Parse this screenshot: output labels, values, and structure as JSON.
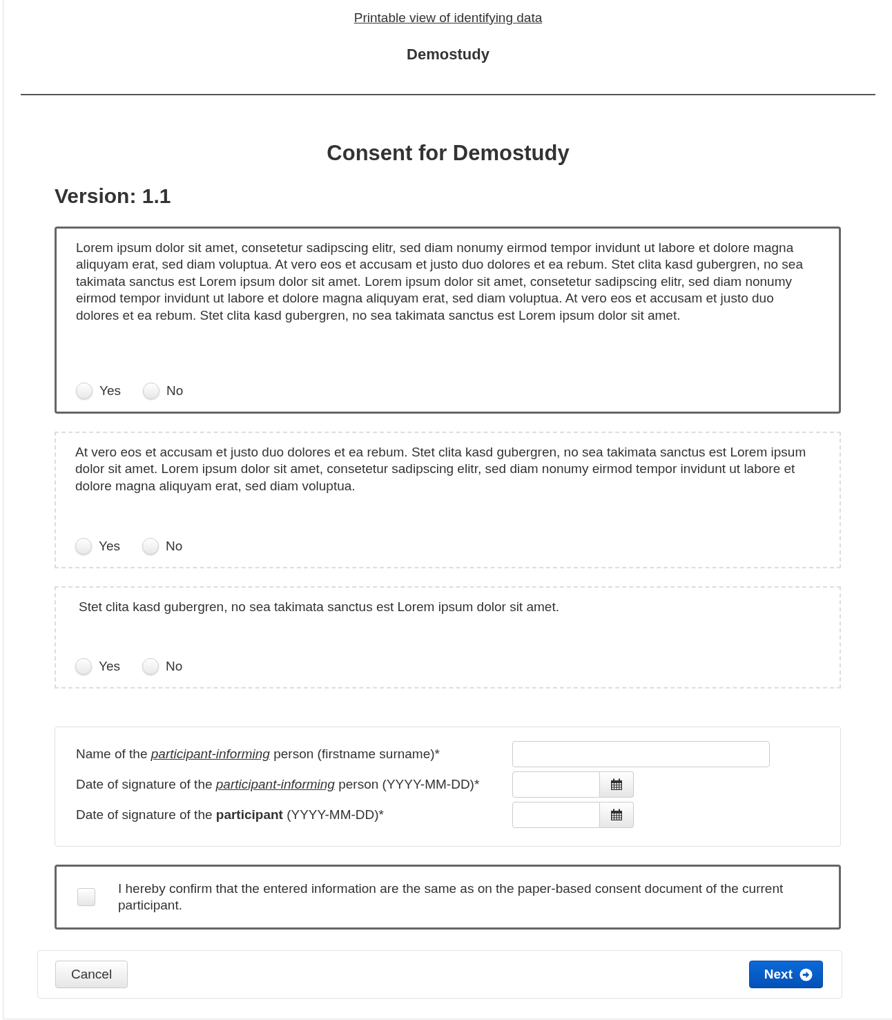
{
  "header": {
    "print_link": "Printable view of identifying data",
    "study": "Demostudy"
  },
  "title": "Consent for Demostudy",
  "version": "Version: 1.1",
  "consent_items": [
    {
      "highlighted": true,
      "text": "Lorem ipsum dolor sit amet, consetetur sadipscing elitr, sed diam nonumy eirmod tempor invidunt ut labore et dolore magna aliquyam erat, sed diam voluptua. At vero eos et accusam et justo duo dolores et ea rebum. Stet clita kasd gubergren, no sea takimata sanctus est Lorem ipsum dolor sit amet. Lorem ipsum dolor sit amet, consetetur sadipscing elitr, sed diam nonumy eirmod tempor invidunt ut labore et dolore magna aliquyam erat, sed diam voluptua. At vero eos et accusam et justo duo dolores et ea rebum. Stet clita kasd gubergren, no sea takimata sanctus est Lorem ipsum dolor sit amet.",
      "options": [
        {
          "label": "Yes",
          "selected": false
        },
        {
          "label": "No",
          "selected": false
        }
      ]
    },
    {
      "highlighted": false,
      "text": "At vero eos et accusam et justo duo dolores et ea rebum. Stet clita kasd gubergren, no sea takimata sanctus est Lorem ipsum dolor sit amet. Lorem ipsum dolor sit amet, consetetur sadipscing elitr, sed diam nonumy eirmod tempor invidunt ut labore et dolore magna aliquyam erat, sed diam voluptua.",
      "options": [
        {
          "label": "Yes",
          "selected": false
        },
        {
          "label": "No",
          "selected": false
        }
      ]
    },
    {
      "highlighted": false,
      "text": "Stet clita kasd gubergren, no sea takimata sanctus est Lorem ipsum dolor sit amet.",
      "options": [
        {
          "label": "Yes",
          "selected": false
        },
        {
          "label": "No",
          "selected": false
        }
      ]
    }
  ],
  "fields": [
    {
      "kind": "text",
      "label": [
        {
          "kind": "plain",
          "text": "Name of the "
        },
        {
          "kind": "link",
          "text": "participant-informing"
        },
        {
          "kind": "plain",
          "text": " person (firstname surname)*"
        }
      ]
    },
    {
      "kind": "date",
      "label": [
        {
          "kind": "plain",
          "text": "Date of signature of the "
        },
        {
          "kind": "link",
          "text": "participant-informing"
        },
        {
          "kind": "plain",
          "text": " person (YYYY-MM-DD)*"
        }
      ]
    },
    {
      "kind": "date",
      "label": [
        {
          "kind": "plain",
          "text": "Date of signature of the "
        },
        {
          "kind": "bold",
          "text": "participant"
        },
        {
          "kind": "plain",
          "text": " (YYYY-MM-DD)*"
        }
      ]
    }
  ],
  "confirmation": {
    "checked": false,
    "text": "I hereby confirm that the entered information are the same as on the paper-based consent document of the current participant."
  },
  "buttons": {
    "cancel": "Cancel",
    "next": "Next"
  }
}
